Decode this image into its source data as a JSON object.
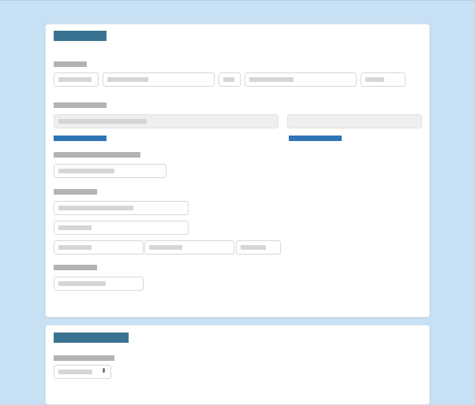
{
  "colors": {
    "page_background": "#c8e0f4",
    "card_background": "#ffffff",
    "section_title": "#3a7391",
    "label": "#b3b3b3",
    "link": "#2f74b5",
    "input_border": "#d8d8d8",
    "disabled_input": "#efefef"
  },
  "select": {
    "arrow_icon": "updown-caret-icon",
    "arrow_glyph": "⬍"
  }
}
